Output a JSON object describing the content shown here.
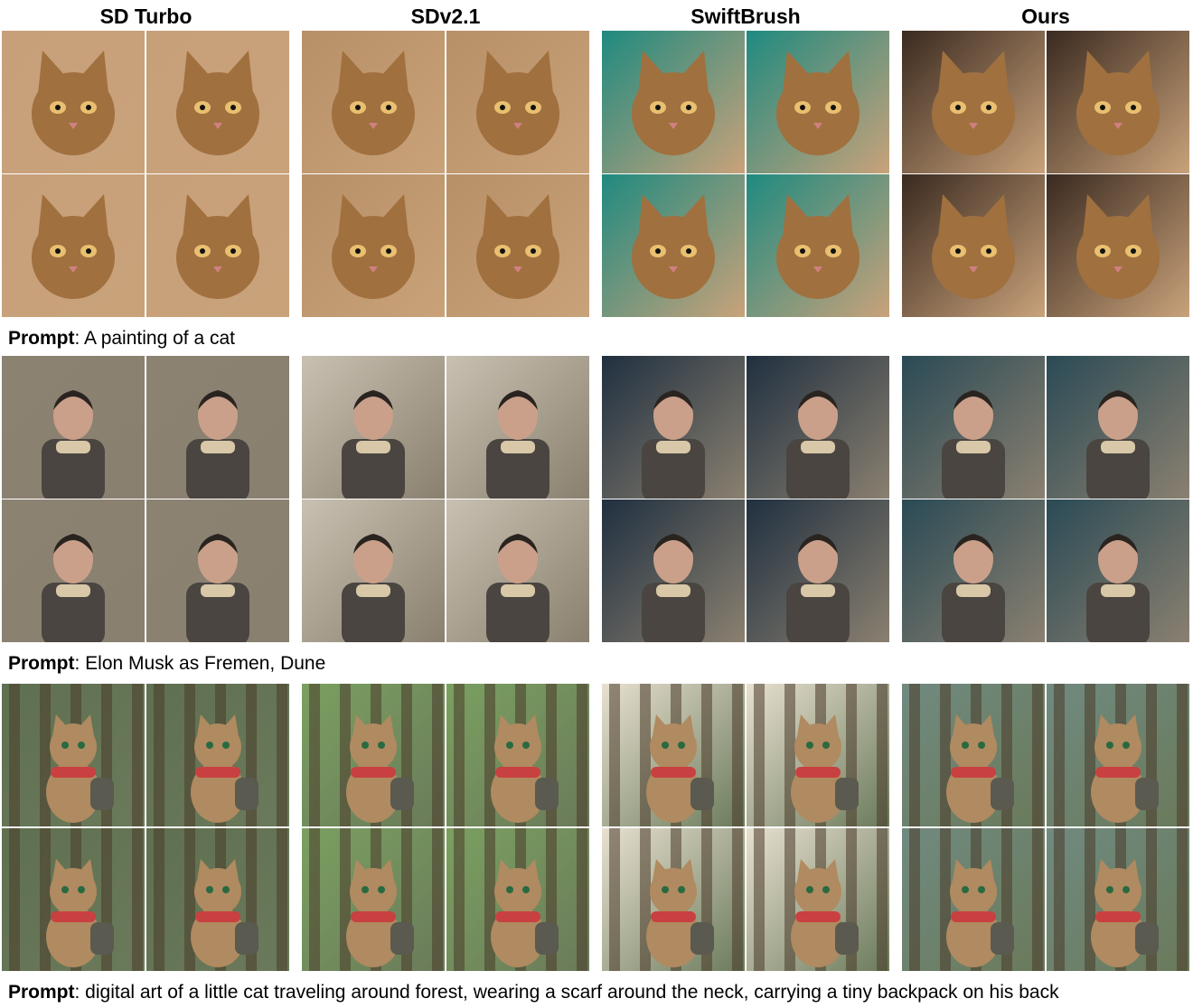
{
  "columns": [
    "SD Turbo",
    "SDv2.1",
    "SwiftBrush",
    "Ours"
  ],
  "prompt_label": "Prompt",
  "prompts": [
    "A painting of a cat",
    "Elon Musk as Fremen, Dune",
    "digital art of a little cat traveling around forest, wearing a scarf around the neck, carrying a tiny backpack on his back"
  ],
  "palettes": {
    "cat_painting": {
      "bg": "#c9a27a",
      "subject": "#a0703f",
      "accent": "#e8c070"
    },
    "fremen": {
      "bg": "#8a8070",
      "subject": "#4a4540",
      "accent": "#d8c8a8"
    },
    "forest_cat": {
      "bg": "#6a7a5a",
      "subject": "#b08a60",
      "accent": "#c84040"
    }
  }
}
